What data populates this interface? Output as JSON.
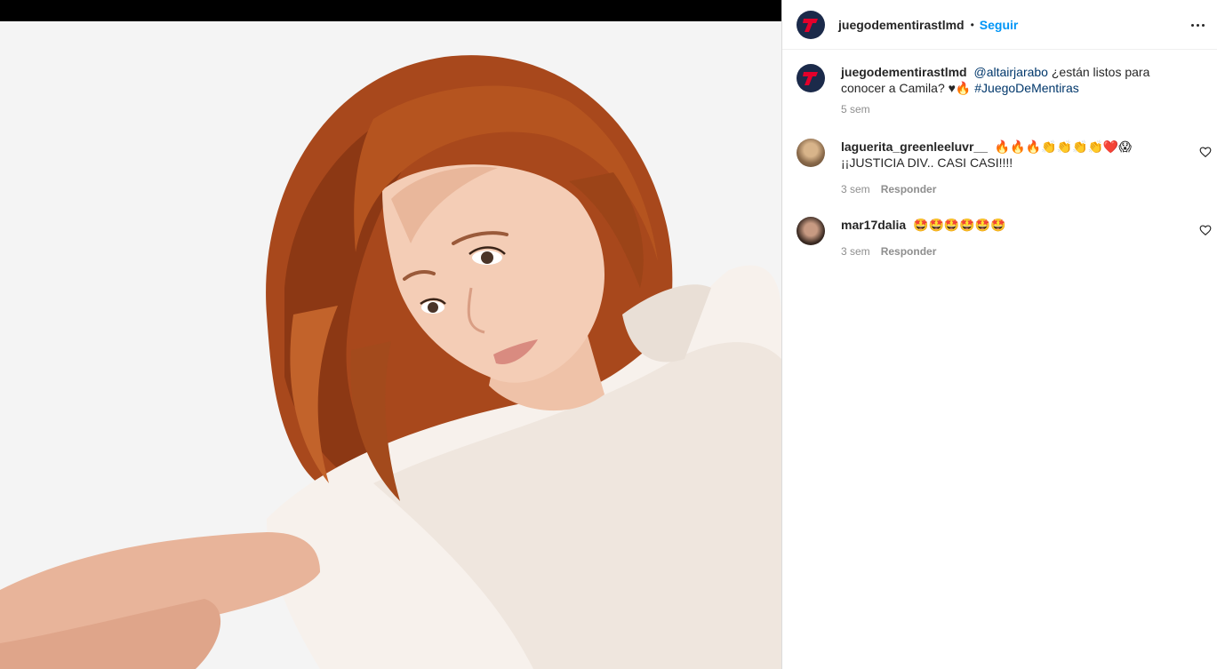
{
  "post": {
    "image_alt": "Mujer pelirroja con camisa blanca",
    "colors": {
      "follow": "#0095f6",
      "mention": "#00376b",
      "meta": "#8e8e8e",
      "logo_bg": "#1b2a4a",
      "logo_red": "#e4002b"
    }
  },
  "header": {
    "username": "juegodementirastlmd",
    "separator": "•",
    "follow_label": "Seguir",
    "more_icon": "more-horizontal-icon"
  },
  "caption": {
    "username": "juegodementirastlmd",
    "mention": "@altairjarabo",
    "text": "¿están listos para conocer a Camila? ♥🔥",
    "hashtag": "#JuegoDeMentiras",
    "time": "5 sem"
  },
  "comments": [
    {
      "username": "laguerita_greenleeluvr__",
      "text": "🔥🔥🔥👏👏👏👏❤️😱 ¡¡JUSTICIA DIV.. CASI CASI!!!!",
      "time": "3 sem",
      "reply_label": "Responder",
      "like_icon": "heart-outline-icon"
    },
    {
      "username": "mar17dalia",
      "text": "🤩🤩🤩🤩🤩🤩",
      "time": "3 sem",
      "reply_label": "Responder",
      "like_icon": "heart-outline-icon"
    }
  ]
}
